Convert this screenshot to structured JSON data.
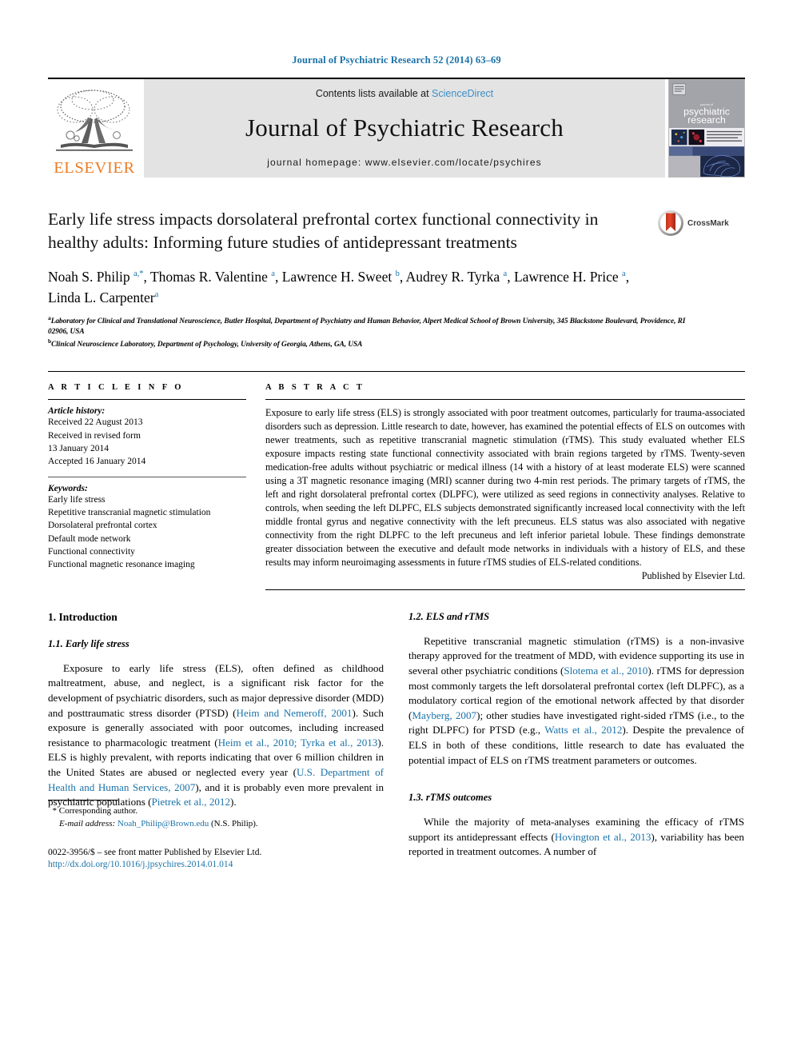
{
  "running_head": "Journal of Psychiatric Research 52 (2014) 63–69",
  "masthead": {
    "publisher_logo_label": "ELSEVIER",
    "contents_prefix": "Contents lists available at ",
    "contents_link": "ScienceDirect",
    "journal_name": "Journal of Psychiatric Research",
    "homepage_line": "journal homepage: www.elsevier.com/locate/psychires",
    "cover_line1": "journal of",
    "cover_line2": "psychiatric",
    "cover_line3": "research"
  },
  "article": {
    "title": "Early life stress impacts dorsolateral prefrontal cortex functional connectivity in healthy adults: Informing future studies of antidepressant treatments",
    "crossmark_label": "CrossMark",
    "authors_html": "Noah S. Philip <sup>a,*</sup>, Thomas R. Valentine <sup>a</sup>, Lawrence H. Sweet <sup>b</sup>, Audrey R. Tyrka <sup>a</sup>, Lawrence H. Price <sup>a</sup>, Linda L. Carpenter<sup>a</sup>",
    "affiliation_a": "Laboratory for Clinical and Translational Neuroscience, Butler Hospital, Department of Psychiatry and Human Behavior, Alpert Medical School of Brown University, 345 Blackstone Boulevard, Providence, RI 02906, USA",
    "affiliation_b": "Clinical Neuroscience Laboratory, Department of Psychology, University of Georgia, Athens, GA, USA"
  },
  "article_info": {
    "heading": "A R T I C L E  I N F O",
    "history_label": "Article history:",
    "history": [
      "Received 22 August 2013",
      "Received in revised form",
      "13 January 2014",
      "Accepted 16 January 2014"
    ],
    "keywords_label": "Keywords:",
    "keywords": [
      "Early life stress",
      "Repetitive transcranial magnetic stimulation",
      "Dorsolateral prefrontal cortex",
      "Default mode network",
      "Functional connectivity",
      "Functional magnetic resonance imaging"
    ]
  },
  "abstract": {
    "heading": "A B S T R A C T",
    "text": "Exposure to early life stress (ELS) is strongly associated with poor treatment outcomes, particularly for trauma-associated disorders such as depression. Little research to date, however, has examined the potential effects of ELS on outcomes with newer treatments, such as repetitive transcranial magnetic stimulation (rTMS). This study evaluated whether ELS exposure impacts resting state functional connectivity associated with brain regions targeted by rTMS. Twenty-seven medication-free adults without psychiatric or medical illness (14 with a history of at least moderate ELS) were scanned using a 3T magnetic resonance imaging (MRI) scanner during two 4-min rest periods. The primary targets of rTMS, the left and right dorsolateral prefrontal cortex (DLPFC), were utilized as seed regions in connectivity analyses. Relative to controls, when seeding the left DLPFC, ELS subjects demonstrated significantly increased local connectivity with the left middle frontal gyrus and negative connectivity with the left precuneus. ELS status was also associated with negative connectivity from the right DLPFC to the left precuneus and left inferior parietal lobule. These findings demonstrate greater dissociation between the executive and default mode networks in individuals with a history of ELS, and these results may inform neuroimaging assessments in future rTMS studies of ELS-related conditions.",
    "publisher_note": "Published by Elsevier Ltd."
  },
  "body": {
    "section1_heading": "1.  Introduction",
    "sub11_heading": "1.1.  Early life stress",
    "para11_html": "Exposure to early life stress (ELS), often defined as childhood maltreatment, abuse, and neglect, is a significant risk factor for the development of psychiatric disorders, such as major depressive disorder (MDD) and posttraumatic stress disorder (PTSD) (<span class=\"ref\">Heim and Nemeroff, 2001</span>). Such exposure is generally associated with poor outcomes, including increased resistance to pharmacologic treatment (<span class=\"ref\">Heim et al., 2010; Tyrka et al., 2013</span>). ELS is highly prevalent, with reports indicating that over 6 million children in the United States are abused or neglected every year (<span class=\"ref\">U.S. Department of Health and Human Services, 2007</span>), and it is probably even more prevalent in psychiatric populations (<span class=\"ref\">Pietrek et al., 2012</span>).",
    "sub12_heading": "1.2.  ELS and rTMS",
    "para12_html": "Repetitive transcranial magnetic stimulation (rTMS) is a non-invasive therapy approved for the treatment of MDD, with evidence supporting its use in several other psychiatric conditions (<span class=\"ref\">Slotema et al., 2010</span>). rTMS for depression most commonly targets the left dorsolateral prefrontal cortex (left DLPFC), as a modulatory cortical region of the emotional network affected by that disorder (<span class=\"ref\">Mayberg, 2007</span>); other studies have investigated right-sided rTMS (i.e., to the right DLPFC) for PTSD (e.g., <span class=\"ref\">Watts et al., 2012</span>). Despite the prevalence of ELS in both of these conditions, little research to date has evaluated the potential impact of ELS on rTMS treatment parameters or outcomes.",
    "sub13_heading": "1.3.  rTMS outcomes",
    "para13_html": "While the majority of meta-analyses examining the efficacy of rTMS support its antidepressant effects (<span class=\"ref\">Hovington et al., 2013</span>), variability has been reported in treatment outcomes. A number of"
  },
  "footnotes": {
    "corresponding_marker": "*",
    "corresponding_text": "Corresponding author.",
    "email_label": "E-mail address:",
    "email": "Noah_Philip@Brown.edu",
    "email_suffix": "(N.S. Philip).",
    "issn_line": "0022-3956/$ – see front matter Published by Elsevier Ltd.",
    "doi": "http://dx.doi.org/10.1016/j.jpsychires.2014.01.014"
  },
  "colors": {
    "link_blue": "#1a72a8",
    "sciencedirect_blue": "#3d8fc6",
    "elsevier_orange": "#ec7c26",
    "masthead_gray": "#e3e3e3"
  }
}
